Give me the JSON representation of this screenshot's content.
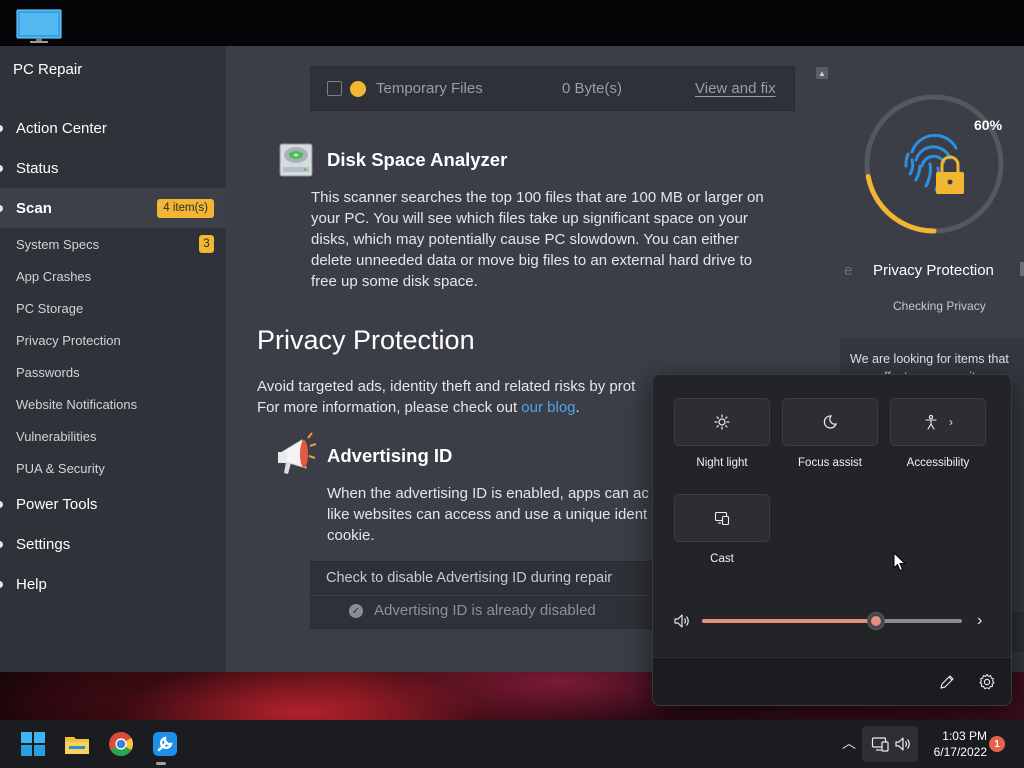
{
  "app": {
    "title": "PC Repair"
  },
  "sidebar": {
    "items": [
      {
        "label": "Action Center"
      },
      {
        "label": "Status"
      },
      {
        "label": "Scan",
        "badge": "4 item(s)"
      },
      {
        "label": "Power Tools"
      },
      {
        "label": "Settings"
      },
      {
        "label": "Help"
      }
    ],
    "sub_items": [
      {
        "label": "System Specs",
        "badge": "3"
      },
      {
        "label": "App Crashes"
      },
      {
        "label": "PC Storage"
      },
      {
        "label": "Privacy Protection"
      },
      {
        "label": "Passwords"
      },
      {
        "label": "Website Notifications"
      },
      {
        "label": "Vulnerabilities"
      },
      {
        "label": "PUA & Security"
      }
    ]
  },
  "main": {
    "temp_files": {
      "name": "Temporary Files",
      "size": "0 Byte(s)",
      "action": "View and fix"
    },
    "disk": {
      "title": "Disk Space Analyzer",
      "lines": [
        "This scanner searches the top 100 files that are 100 MB or larger on",
        "your PC. You will see which files take up significant space on your",
        "disks, which may potentially cause PC slowdown. You can either",
        "delete unneeded data or move big files to an external hard drive to",
        "free up some disk space."
      ]
    },
    "privacy": {
      "title": "Privacy Protection",
      "line1": "Avoid targeted ads, identity theft and related risks by prot",
      "line2_prefix": "For more information, please check out ",
      "link": "our blog",
      "line2_suffix": "."
    },
    "advertising": {
      "title": "Advertising ID",
      "lines": [
        "When the advertising ID is enabled, apps can ac",
        "like websites can access and use a unique ident",
        "cookie."
      ],
      "checkbox_label": "Check to disable Advertising ID during repair",
      "status": "Advertising ID is already disabled"
    }
  },
  "right_panel": {
    "progress_percent": 60,
    "progress_label": "60%",
    "ghost_left": "e",
    "title": "Privacy Protection",
    "status": "Checking Privacy",
    "card_lines": [
      "We are looking for items that",
      "may affect your security"
    ]
  },
  "quick_settings": {
    "tiles": [
      {
        "label": "Night light",
        "icon": "brightness-icon"
      },
      {
        "label": "Focus assist",
        "icon": "moon-icon"
      },
      {
        "label": "Accessibility",
        "icon": "accessibility-icon"
      },
      {
        "label": "Cast",
        "icon": "cast-icon"
      }
    ],
    "volume_percent": 67,
    "accent_color": "#e48f80"
  },
  "taskbar": {
    "clock_time": "1:03 PM",
    "clock_date": "6/17/2022",
    "notification_count": "1"
  }
}
